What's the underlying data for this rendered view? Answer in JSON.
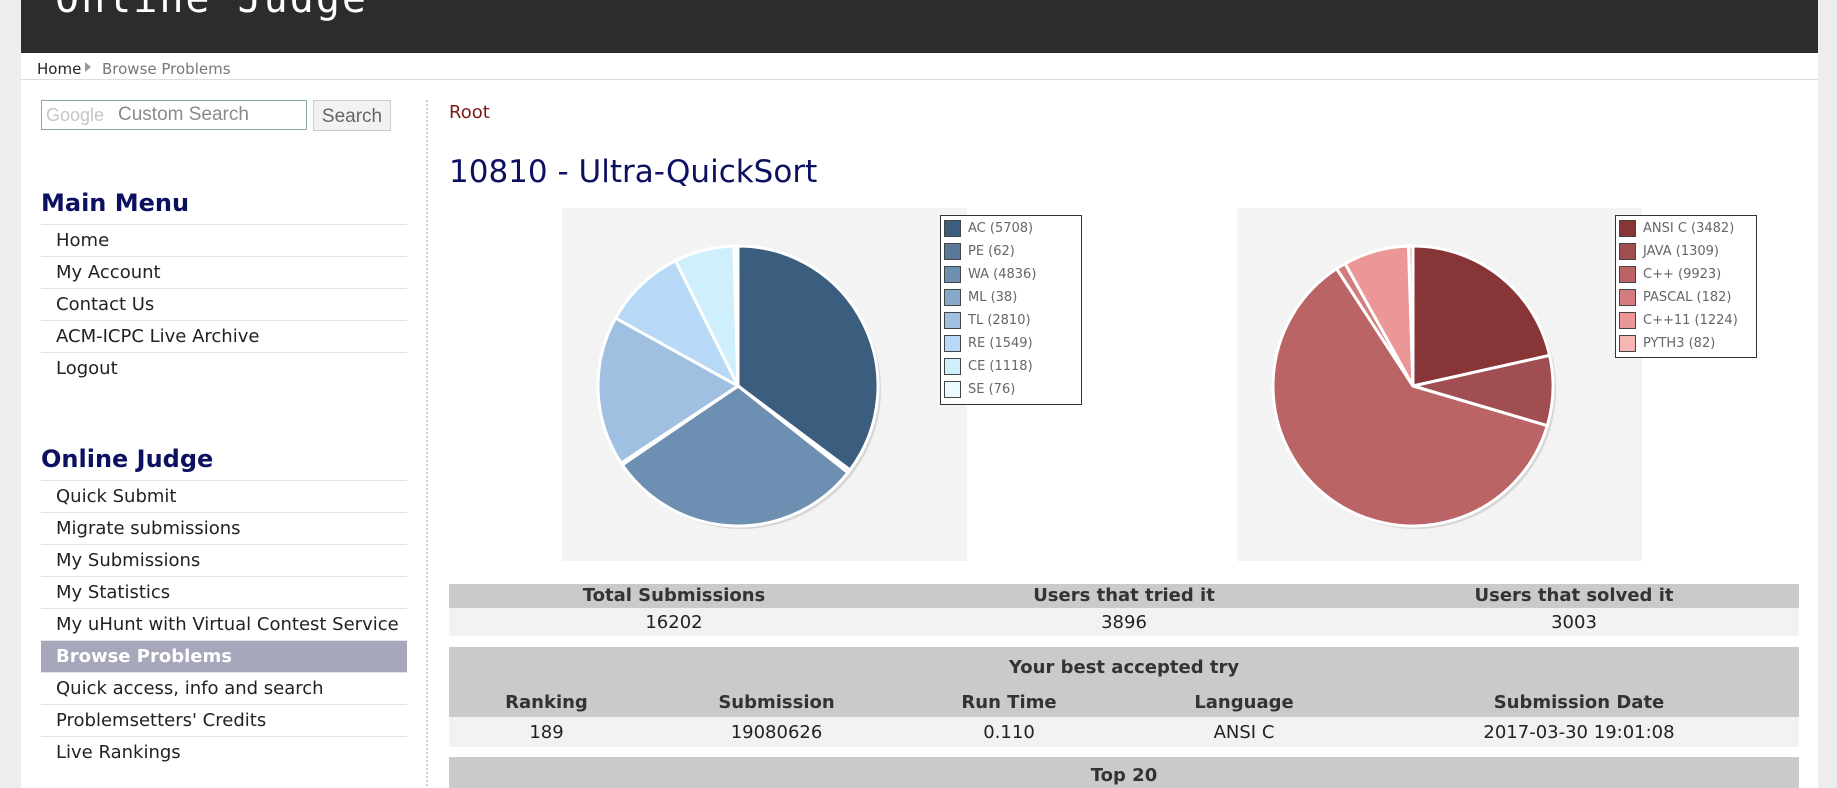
{
  "header": {
    "site_title": "Online Judge"
  },
  "breadcrumb": {
    "home": "Home",
    "current": "Browse Problems"
  },
  "search": {
    "brand": "Google",
    "placeholder": "Custom Search",
    "button": "Search"
  },
  "sidebar": {
    "main_menu": {
      "title": "Main Menu",
      "items": [
        "Home",
        "My Account",
        "Contact Us",
        "ACM-ICPC Live Archive",
        "Logout"
      ]
    },
    "online_judge": {
      "title": "Online Judge",
      "items": [
        "Quick Submit",
        "Migrate submissions",
        "My Submissions",
        "My Statistics",
        "My uHunt with Virtual Contest Service",
        "Browse Problems",
        "Quick access, info and search",
        "Problemsetters' Credits",
        "Live Rankings"
      ],
      "active_index": 5
    }
  },
  "main": {
    "root_link": "Root",
    "problem_title": "10810 - Ultra-QuickSort"
  },
  "chart_data": [
    {
      "type": "pie",
      "title": "",
      "legend": "top-right",
      "slices": [
        {
          "label": "AC (5708)",
          "value": 5708,
          "color": "#3b5d7e"
        },
        {
          "label": "PE (62)",
          "value": 62,
          "color": "#5a7898"
        },
        {
          "label": "WA (4836)",
          "value": 4836,
          "color": "#6d8fb1"
        },
        {
          "label": "ML (38)",
          "value": 38,
          "color": "#86a8cb"
        },
        {
          "label": "TL (2810)",
          "value": 2810,
          "color": "#9fc0e1"
        },
        {
          "label": "RE (1549)",
          "value": 1549,
          "color": "#b7d8f7"
        },
        {
          "label": "CE (1118)",
          "value": 1118,
          "color": "#d0effd"
        },
        {
          "label": "SE (76)",
          "value": 76,
          "color": "#e9fbff"
        }
      ]
    },
    {
      "type": "pie",
      "title": "",
      "legend": "top-right",
      "slices": [
        {
          "label": "ANSI C (3482)",
          "value": 3482,
          "color": "#883538"
        },
        {
          "label": "JAVA (1309)",
          "value": 1309,
          "color": "#a04e52"
        },
        {
          "label": "C++ (9923)",
          "value": 9923,
          "color": "#ba6466"
        },
        {
          "label": "PASCAL (182)",
          "value": 182,
          "color": "#d27c7e"
        },
        {
          "label": "C++11 (1224)",
          "value": 1224,
          "color": "#eb9797"
        },
        {
          "label": "PYTH3 (82)",
          "value": 82,
          "color": "#f7b6b4"
        }
      ]
    }
  ],
  "stats": {
    "headers": [
      "Total Submissions",
      "Users that tried it",
      "Users that solved it"
    ],
    "values": [
      "16202",
      "3896",
      "3003"
    ]
  },
  "best_try": {
    "title": "Your best accepted try",
    "headers": [
      "Ranking",
      "Submission",
      "Run Time",
      "Language",
      "Submission Date"
    ],
    "values": [
      "189",
      "19080626",
      "0.110",
      "ANSI C",
      "2017-03-30 19:01:08"
    ]
  },
  "top20": {
    "title": "Top 20"
  }
}
